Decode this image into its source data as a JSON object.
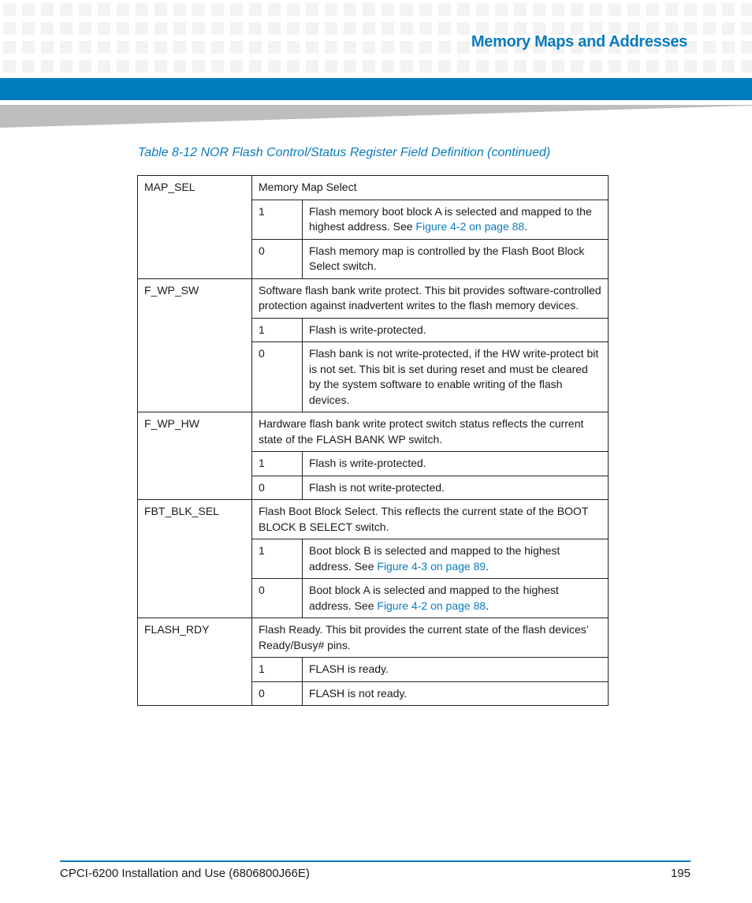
{
  "header": {
    "chapter_title": "Memory Maps and Addresses",
    "accent_color": "#007cbd"
  },
  "table": {
    "caption": "Table 8-12 NOR Flash Control/Status Register Field Definition (continued)",
    "fields": [
      {
        "name": "MAP_SEL",
        "description": "Memory Map Select",
        "values": [
          {
            "bit": "1",
            "text": "Flash memory boot block A is selected and mapped to the highest address. See ",
            "link": "Figure 4-2 on page 88",
            "suffix": "."
          },
          {
            "bit": "0",
            "text": "Flash memory map is controlled by the Flash Boot Block Select switch.",
            "link": "",
            "suffix": ""
          }
        ]
      },
      {
        "name": "F_WP_SW",
        "description": "Software flash bank write protect. This bit provides software-controlled protection against inadvertent writes to the flash memory devices.",
        "values": [
          {
            "bit": "1",
            "text": "Flash is write-protected.",
            "link": "",
            "suffix": ""
          },
          {
            "bit": "0",
            "text": "Flash bank is not write-protected, if the HW write-protect bit is not set. This bit is set during reset and must be cleared by the system software to enable writing of the flash devices.",
            "link": "",
            "suffix": ""
          }
        ]
      },
      {
        "name": "F_WP_HW",
        "description": "Hardware flash bank write protect switch status reflects the current state of the FLASH BANK WP switch.",
        "values": [
          {
            "bit": "1",
            "text": "Flash is write-protected.",
            "link": "",
            "suffix": ""
          },
          {
            "bit": "0",
            "text": "Flash is not write-protected.",
            "link": "",
            "suffix": ""
          }
        ]
      },
      {
        "name": "FBT_BLK_SEL",
        "description": "Flash Boot Block Select. This reflects the current state of the BOOT BLOCK B SELECT switch.",
        "values": [
          {
            "bit": "1",
            "text": "Boot block B is selected and mapped to the highest address. See ",
            "link": "Figure 4-3 on page 89",
            "suffix": "."
          },
          {
            "bit": "0",
            "text": "Boot block A is selected and mapped to the highest address. See ",
            "link": "Figure 4-2 on page 88",
            "suffix": "."
          }
        ]
      },
      {
        "name": "FLASH_RDY",
        "description": "Flash Ready. This bit provides the current state of the flash devices’ Ready/Busy# pins.",
        "values": [
          {
            "bit": "1",
            "text": "FLASH is ready.",
            "link": "",
            "suffix": ""
          },
          {
            "bit": "0",
            "text": "FLASH is not ready.",
            "link": "",
            "suffix": ""
          }
        ]
      }
    ]
  },
  "footer": {
    "document": "CPCI-6200 Installation and Use (6806800J66E)",
    "page_number": "195"
  }
}
